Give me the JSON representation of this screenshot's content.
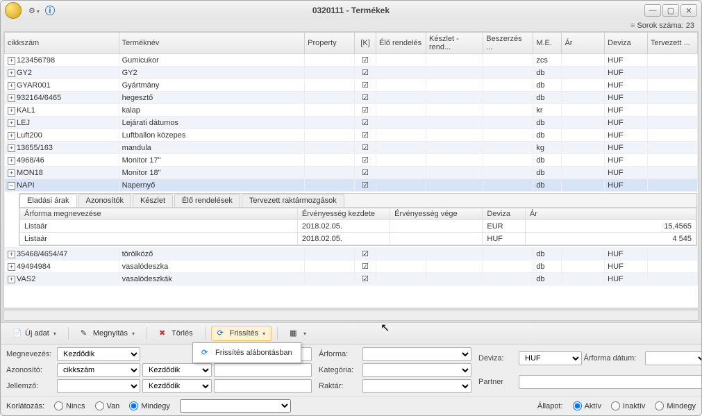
{
  "titlebar": {
    "title": "0320111 - Termékek"
  },
  "rowcount": "Sorok száma: 23",
  "columns": [
    "cikkszám",
    "Terméknév",
    "Property",
    "[K]",
    "Élő rendelés",
    "Készlet - rend...",
    "Beszerzés ...",
    "M.E.",
    "Ár",
    "Deviza",
    "Tervezett ..."
  ],
  "rows": [
    {
      "ck": "123456798",
      "tn": "Gumicukor",
      "k": true,
      "me": "zcs",
      "dv": "HUF",
      "alt": false
    },
    {
      "ck": "GY2",
      "tn": "GY2",
      "k": true,
      "me": "db",
      "dv": "HUF",
      "alt": true
    },
    {
      "ck": "GYAR001",
      "tn": "Gyártmány",
      "k": true,
      "me": "db",
      "dv": "HUF",
      "alt": false
    },
    {
      "ck": "932164/6465",
      "tn": "hegesztő",
      "k": true,
      "me": "db",
      "dv": "HUF",
      "alt": true
    },
    {
      "ck": "KAL1",
      "tn": "kalap",
      "k": true,
      "me": "kr",
      "dv": "HUF",
      "alt": false
    },
    {
      "ck": "LEJ",
      "tn": "Lejárati dátumos",
      "k": true,
      "me": "db",
      "dv": "HUF",
      "alt": true
    },
    {
      "ck": "Luft200",
      "tn": "Luftballon közepes",
      "k": true,
      "me": "db",
      "dv": "HUF",
      "alt": false
    },
    {
      "ck": "13655/163",
      "tn": "mandula",
      "k": true,
      "me": "kg",
      "dv": "HUF",
      "alt": true
    },
    {
      "ck": "4968/46",
      "tn": "Monitor 17\"",
      "k": true,
      "me": "db",
      "dv": "HUF",
      "alt": false
    },
    {
      "ck": "MON18",
      "tn": "Monitor 18\"",
      "k": true,
      "me": "db",
      "dv": "HUF",
      "alt": true
    }
  ],
  "selected_row": {
    "ck": "NAPI",
    "tn": "Napernyő",
    "k": true,
    "me": "db",
    "dv": "HUF"
  },
  "bottom_rows": [
    {
      "ck": "35468/4654/47",
      "tn": "törölköző",
      "k": true,
      "me": "db",
      "dv": "HUF",
      "alt": true
    },
    {
      "ck": "49494984",
      "tn": "vasalódeszka",
      "k": true,
      "me": "db",
      "dv": "HUF",
      "alt": false
    },
    {
      "ck": "VAS2",
      "tn": "vasalódeszkák",
      "k": true,
      "me": "db",
      "dv": "HUF",
      "alt": true
    }
  ],
  "detail": {
    "tabs": [
      "Eladási árak",
      "Azonosítók",
      "Készlet",
      "Élő rendelések",
      "Tervezett raktármozgások"
    ],
    "active_tab": "Eladási árak",
    "headers": [
      "Árforma megnevezése",
      "Érvényesség kezdete",
      "Érvényesség vége",
      "Deviza",
      "Ár"
    ],
    "rows": [
      {
        "a": "Listaár",
        "b": "2018.02.05.",
        "c": "",
        "d": "EUR",
        "e": "15,4565"
      },
      {
        "a": "Listaár",
        "b": "2018.02.05.",
        "c": "",
        "d": "HUF",
        "e": "4 545"
      }
    ]
  },
  "toolbar": {
    "uj_adat": "Új adat",
    "megnyitas": "Megnyitás",
    "torles": "Törlés",
    "frissites": "Frissítés",
    "popup_item": "Frissítés alábontásban"
  },
  "filters": {
    "megnevezes_label": "Megnevezés:",
    "megnevezes_op": "Kezdődik",
    "azonosito_label": "Azonosító:",
    "azonosito_field": "cikkszám",
    "azonosito_op": "Kezdődik",
    "jellemzo_label": "Jellemző:",
    "jellemzo_op": "Kezdődik",
    "arforma_label": "Árforma:",
    "kategoria_label": "Kategória:",
    "raktar_label": "Raktár:",
    "deviza_label": "Deviza:",
    "deviza_value": "HUF",
    "arforma_datum_label": "Árforma dátum:",
    "partner_label": "Partner"
  },
  "korlat": {
    "label": "Korlátozás:",
    "nincs": "Nincs",
    "van": "Van",
    "mindegy": "Mindegy",
    "allapot_label": "Állapot:",
    "aktiv": "Aktív",
    "inaktiv": "Inaktív",
    "mindegy2": "Mindegy"
  }
}
